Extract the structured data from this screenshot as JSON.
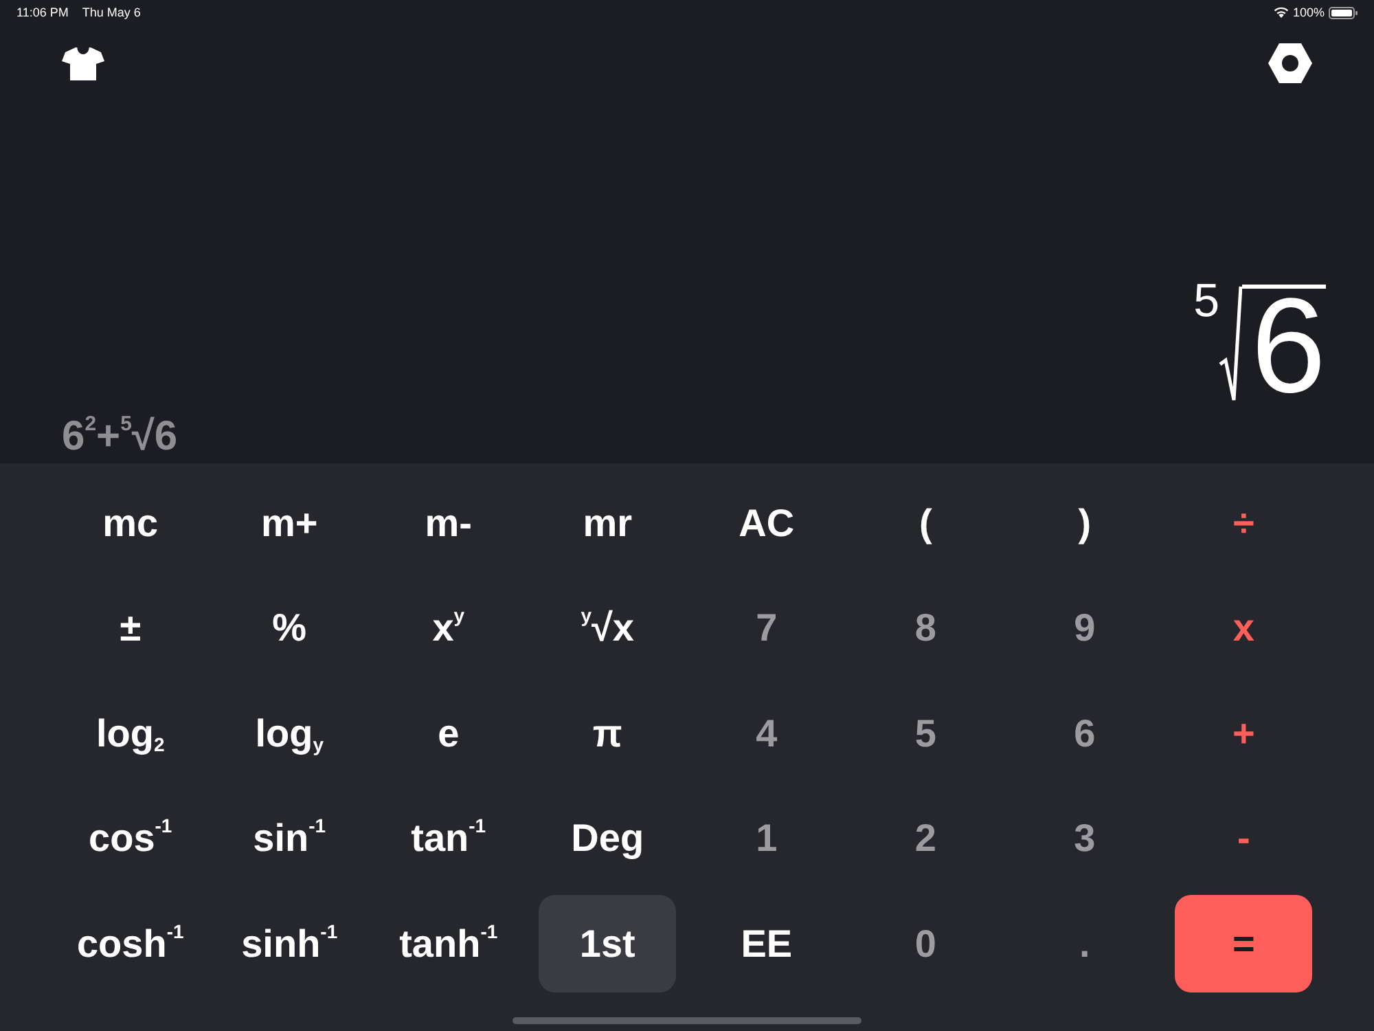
{
  "status_bar": {
    "time": "11:06 PM",
    "date": "Thu May 6",
    "battery": "100%"
  },
  "display": {
    "result": {
      "index": "5",
      "radicand": "6"
    },
    "expression": "6$^{2}$+$^{5}$√6"
  },
  "keypad": {
    "keys": [
      {
        "label": "mc",
        "kind": "function",
        "selected": false
      },
      {
        "label": "m+",
        "kind": "function",
        "selected": false
      },
      {
        "label": "m-",
        "kind": "function",
        "selected": false
      },
      {
        "label": "mr",
        "kind": "function",
        "selected": false
      },
      {
        "label": "AC",
        "kind": "function",
        "selected": false
      },
      {
        "label": "(",
        "kind": "function",
        "selected": false
      },
      {
        "label": ")",
        "kind": "function",
        "selected": false
      },
      {
        "label": "÷",
        "kind": "operator",
        "selected": false
      },
      {
        "label": "±",
        "kind": "function",
        "selected": false
      },
      {
        "label": "%",
        "kind": "function",
        "selected": false
      },
      {
        "label": "x$^{y}$",
        "kind": "function",
        "selected": false
      },
      {
        "label": "$^{y}$√x",
        "kind": "function",
        "selected": false
      },
      {
        "label": "7",
        "kind": "digit",
        "selected": false
      },
      {
        "label": "8",
        "kind": "digit",
        "selected": false
      },
      {
        "label": "9",
        "kind": "digit",
        "selected": false
      },
      {
        "label": "x",
        "kind": "operator",
        "selected": false
      },
      {
        "label": "log$_{2}$",
        "kind": "function",
        "selected": false
      },
      {
        "label": "log$_{y}$",
        "kind": "function",
        "selected": false
      },
      {
        "label": "e",
        "kind": "function",
        "selected": false
      },
      {
        "label": "π",
        "kind": "function",
        "selected": false
      },
      {
        "label": "4",
        "kind": "digit",
        "selected": false
      },
      {
        "label": "5",
        "kind": "digit",
        "selected": false
      },
      {
        "label": "6",
        "kind": "digit",
        "selected": false
      },
      {
        "label": "+",
        "kind": "operator",
        "selected": false
      },
      {
        "label": "cos$^{-1}$",
        "kind": "function",
        "selected": false
      },
      {
        "label": "sin$^{-1}$",
        "kind": "function",
        "selected": false
      },
      {
        "label": "tan$^{-1}$",
        "kind": "function",
        "selected": false
      },
      {
        "label": "Deg",
        "kind": "function",
        "selected": false
      },
      {
        "label": "1",
        "kind": "digit",
        "selected": false
      },
      {
        "label": "2",
        "kind": "digit",
        "selected": false
      },
      {
        "label": "3",
        "kind": "digit",
        "selected": false
      },
      {
        "label": "-",
        "kind": "operator",
        "selected": false
      },
      {
        "label": "cosh$^{-1}$",
        "kind": "function",
        "selected": false
      },
      {
        "label": "sinh$^{-1}$",
        "kind": "function",
        "selected": false
      },
      {
        "label": "tanh$^{-1}$",
        "kind": "function",
        "selected": false
      },
      {
        "label": "1st",
        "kind": "function",
        "selected": true
      },
      {
        "label": "EE",
        "kind": "function",
        "selected": false
      },
      {
        "label": "0",
        "kind": "digit",
        "selected": false
      },
      {
        "label": ".",
        "kind": "digit",
        "selected": false
      },
      {
        "label": "=",
        "kind": "equals",
        "selected": false
      }
    ]
  }
}
